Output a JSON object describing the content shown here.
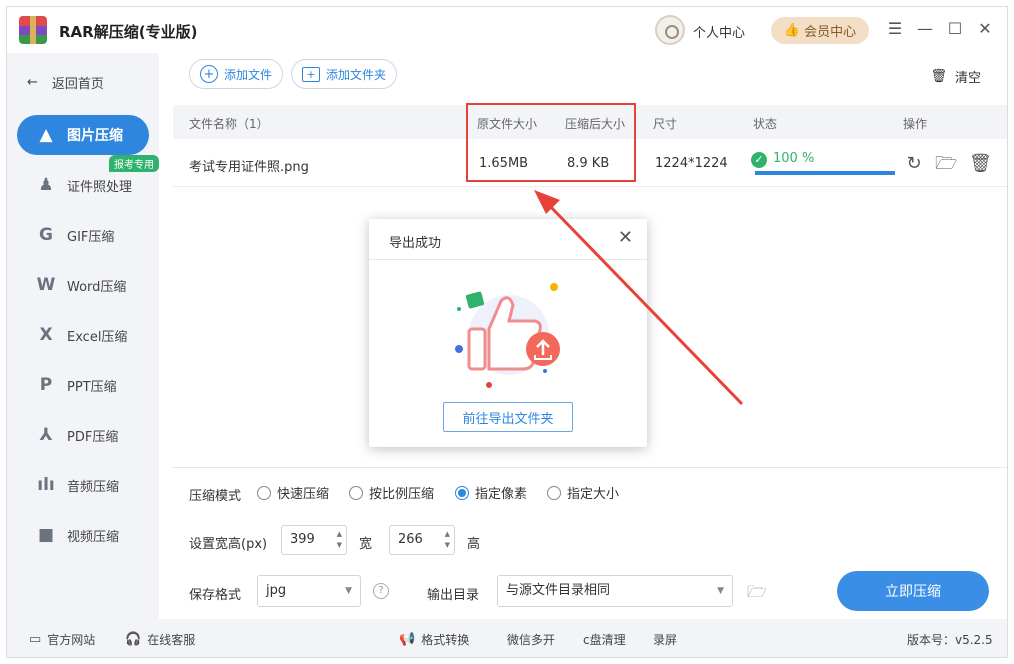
{
  "window": {
    "title": "RAR解压缩(专业版)",
    "user_center": "个人中心",
    "member_center": "会员中心"
  },
  "sidebar": {
    "back_home": "返回首页",
    "badge": "报考专用",
    "items": [
      {
        "label": "图片压缩",
        "icon": "image-icon",
        "active": true
      },
      {
        "label": "证件照处理",
        "icon": "id-photo-icon"
      },
      {
        "label": "GIF压缩",
        "icon": "gif-icon"
      },
      {
        "label": "Word压缩",
        "icon": "word-icon"
      },
      {
        "label": "Excel压缩",
        "icon": "excel-icon"
      },
      {
        "label": "PPT压缩",
        "icon": "ppt-icon"
      },
      {
        "label": "PDF压缩",
        "icon": "pdf-icon"
      },
      {
        "label": "音频压缩",
        "icon": "audio-icon"
      },
      {
        "label": "视频压缩",
        "icon": "video-icon"
      }
    ]
  },
  "toolbar": {
    "add_file": "添加文件",
    "add_folder": "添加文件夹",
    "clear": "清空"
  },
  "table": {
    "headers": {
      "name": "文件名称（1）",
      "original_size": "原文件大小",
      "compressed_size": "压缩后大小",
      "dimensions": "尺寸",
      "status": "状态",
      "actions": "操作"
    },
    "rows": [
      {
        "name": "考试专用证件照.png",
        "original_size": "1.65MB",
        "compressed_size": "8.9 KB",
        "dimensions": "1224*1224",
        "status": "100 %",
        "progress": 1.0
      }
    ]
  },
  "settings": {
    "mode_label": "压缩模式",
    "modes": [
      {
        "label": "快速压缩",
        "checked": false
      },
      {
        "label": "按比例压缩",
        "checked": false
      },
      {
        "label": "指定像素",
        "checked": true
      },
      {
        "label": "指定大小",
        "checked": false
      }
    ],
    "size_label": "设置宽高(px)",
    "width_value": "399",
    "width_label": "宽",
    "height_value": "266",
    "height_label": "高",
    "format_label": "保存格式",
    "format_value": "jpg",
    "output_label": "输出目录",
    "output_value": "与源文件目录相同",
    "compress_button": "立即压缩"
  },
  "footer": {
    "website": "官方网站",
    "service": "在线客服",
    "format_convert": "格式转换",
    "wechat": "微信多开",
    "disk_clean": "c盘清理",
    "record": "录屏",
    "version": "版本号：v5.2.5"
  },
  "modal": {
    "title": "导出成功",
    "button": "前往导出文件夹"
  },
  "colors": {
    "accent": "#2e86de",
    "success": "#2fb36c",
    "highlight": "#e8413a"
  }
}
